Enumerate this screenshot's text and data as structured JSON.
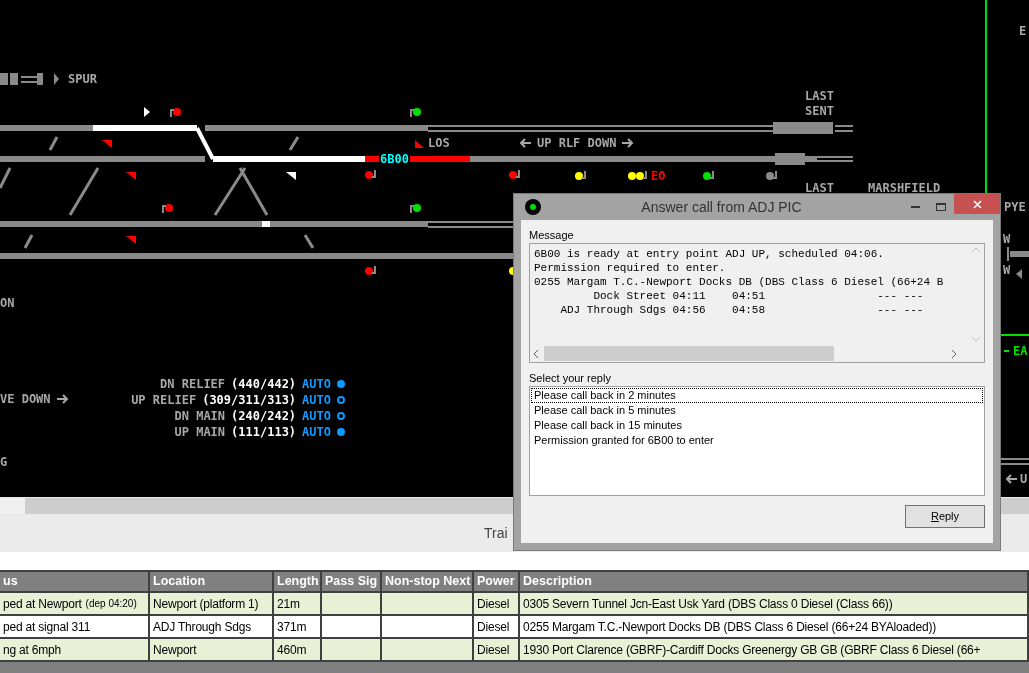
{
  "diagram": {
    "labels": [
      {
        "kind": "plain",
        "text": "SPUR"
      },
      {
        "kind": "plain",
        "text": "LOS"
      },
      {
        "kind": "train",
        "text": "6B00"
      },
      {
        "kind": "arrows",
        "text": "UP RLF DOWN"
      },
      {
        "kind": "plain",
        "text": "LAST"
      },
      {
        "kind": "plain",
        "text": "SENT"
      },
      {
        "kind": "plain",
        "text": "LAST"
      },
      {
        "kind": "plain",
        "text": "MARSHFIELD"
      },
      {
        "kind": "alarm",
        "text": "EO"
      },
      {
        "kind": "plain",
        "text": "E"
      },
      {
        "kind": "plain",
        "text": "PYE"
      },
      {
        "kind": "plain",
        "text": "W"
      },
      {
        "kind": "plain",
        "text": "W"
      },
      {
        "kind": "green",
        "text": "EA"
      },
      {
        "kind": "plain",
        "text": "ON"
      },
      {
        "kind": "right",
        "text": "VE DOWN"
      },
      {
        "kind": "plain",
        "text": "G"
      },
      {
        "kind": "left",
        "text": "U"
      }
    ],
    "routes": [
      {
        "name": "DN RELIEF",
        "signals": "(440/442)",
        "mode": "AUTO",
        "on": true
      },
      {
        "name": "UP RELIEF",
        "signals": "(309/311/313)",
        "mode": "AUTO",
        "on": false
      },
      {
        "name": "DN MAIN",
        "signals": "(240/242)",
        "mode": "AUTO",
        "on": false
      },
      {
        "name": "UP MAIN",
        "signals": "(111/113)",
        "mode": "AUTO",
        "on": true
      }
    ]
  },
  "panel": {
    "title": "Trai"
  },
  "table": {
    "columns": [
      "us",
      "Location",
      "Length",
      "Pass Sig",
      "Non-stop Next",
      "Power",
      "Description"
    ],
    "rows": [
      {
        "highlighted": true,
        "status": "ped at Newport",
        "status_note": "(dep 04:20)",
        "location": "Newport (platform 1)",
        "length": "21m",
        "pass_sig": "",
        "non_stop_next": "",
        "power": "Diesel",
        "description": "0305 Severn Tunnel Jcn-East Usk Yard (DBS Class 0 Diesel (Class 66))"
      },
      {
        "highlighted": false,
        "status": "ped at signal 311",
        "status_note": "",
        "location": "ADJ Through Sdgs",
        "length": "371m",
        "pass_sig": "",
        "non_stop_next": "",
        "power": "Diesel",
        "description": "0255 Margam T.C.-Newport Docks DB (DBS Class 6 Diesel (66+24 BYAloaded))"
      },
      {
        "highlighted": true,
        "status": "ng at 6mph",
        "status_note": "",
        "location": "Newport",
        "length": "460m",
        "pass_sig": "",
        "non_stop_next": "",
        "power": "Diesel",
        "description": "1930 Port Clarence (GBRF)-Cardiff Docks Greenergy GB GB (GBRF Class 6 Diesel (66+"
      }
    ]
  },
  "dialog": {
    "title": "Answer call from ADJ PIC",
    "message_label": "Message",
    "message_lines": [
      "6B00 is ready at entry point ADJ UP, scheduled 04:06.",
      "Permission required to enter.",
      "0255 Margam T.C.-Newport Docks DB (DBS Class 6 Diesel (66+24 B",
      "         Dock Street 04:11    04:51                 --- ---",
      "    ADJ Through Sdgs 04:56    04:58                 --- ---"
    ],
    "reply_label": "Select your reply",
    "replies": [
      {
        "text": "Please call back in 2 minutes",
        "selected": true
      },
      {
        "text": "Please call back in 5 minutes",
        "selected": false
      },
      {
        "text": "Please call back in 15 minutes",
        "selected": false
      },
      {
        "text": "Permission granted for 6B00 to enter",
        "selected": false
      }
    ],
    "button_mnemonic": "R",
    "button_rest": "eply"
  }
}
